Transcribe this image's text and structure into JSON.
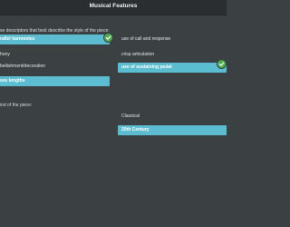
{
  "window": {
    "title": "Musical Features"
  },
  "descriptors": {
    "prompt": "se descriptors that best describe the style of the piece:",
    "left_options": [
      {
        "label": "rallel harmonies",
        "selected": true
      },
      {
        "label": "hony",
        "selected": false
      },
      {
        "label": "bellishment/decoration",
        "selected": false
      },
      {
        "label": "ses lengths",
        "selected": true
      }
    ],
    "right_options": [
      {
        "label": "use of call and response",
        "selected": false
      },
      {
        "label": "crisp articulation",
        "selected": false
      },
      {
        "label": "use of sustaining pedal",
        "selected": true
      }
    ]
  },
  "period": {
    "prompt": "iod of the piece:",
    "options": [
      {
        "label": "Classical",
        "selected": false
      },
      {
        "label": "20th Century",
        "selected": true
      }
    ]
  },
  "colors": {
    "background": "#3b4043",
    "titlebar": "#2a2e31",
    "selected": "#5cbdd0",
    "check": "#4cae4f"
  }
}
